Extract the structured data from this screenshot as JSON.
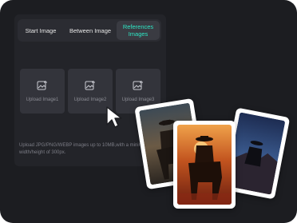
{
  "tabs": [
    {
      "label": "Start Image",
      "active": false
    },
    {
      "label": "Between Image",
      "active": false
    },
    {
      "label": "References\nImages",
      "active": true
    }
  ],
  "upload_slots": [
    {
      "label": "Upload Image1",
      "icon": "image-add-icon"
    },
    {
      "label": "Upload Image2",
      "icon": "image-add-icon"
    },
    {
      "label": "Upload Image3",
      "icon": "image-add-icon"
    }
  ],
  "hint": {
    "line1": "Upload JPG/PNG/WEBP images up to 10MB,with a minimum",
    "line2": "width/height of 300px."
  },
  "colors": {
    "background": "#1c1d21",
    "accent": "#2ee6c4"
  },
  "reference_cards": [
    {
      "subject": "cowboy on horseback at dusk",
      "icon": "photo"
    },
    {
      "subject": "cowboy on horseback with red dust sunset",
      "icon": "photo"
    },
    {
      "subject": "rider on horse in blue canyon night",
      "icon": "photo"
    }
  ]
}
